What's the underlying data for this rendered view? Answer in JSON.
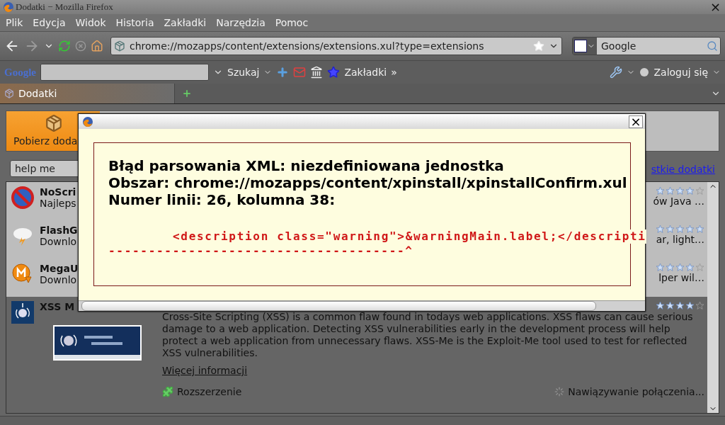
{
  "window": {
    "title": "Dodatki − Mozilla Firefox"
  },
  "menu": [
    "Plik",
    "Edycja",
    "Widok",
    "Historia",
    "Zakładki",
    "Narzędzia",
    "Pomoc"
  ],
  "nav": {
    "forward_disabled": true,
    "url": "chrome://mozapps/content/extensions/extensions.xul?type=extensions",
    "search": "Google"
  },
  "google_toolbar": {
    "logo": "Google",
    "search_button": "Szukaj",
    "bookmarks": "Zakładki",
    "overflow": "»",
    "login": "Zaloguj się"
  },
  "tabs": [
    {
      "label": "Dodatki",
      "selected": true
    }
  ],
  "addons": {
    "get_button": "Pobierz doda",
    "search": {
      "value": "help me"
    },
    "all_link": "stkie dodatki",
    "items": [
      {
        "kind": "blocked",
        "name": "NoScri",
        "description": "Najleps",
        "tail": "ów Java …",
        "stars": 4,
        "selected": false
      },
      {
        "kind": "storm",
        "name": "FlashG",
        "description": "Downlo",
        "tail": "ar, light…",
        "stars": 5,
        "selected": false
      },
      {
        "kind": "download",
        "name": "MegaU",
        "description": "Downlo",
        "tail": "lper wil…",
        "stars": 4,
        "selected": false
      },
      {
        "kind": "globe",
        "name": "XSS M",
        "stars": 4,
        "selected": true,
        "details": {
          "text": "Cross-Site Scripting (XSS) is a common flaw found in todays web applications. XSS flaws can cause serious damage to a web application. Detecting XSS vulnerabilities early in the development process will help protect a web application from unnecessary flaws. XSS-Me is the Exploit-Me tool used to test for reflected XSS vulnerabilities.",
          "more_link": "Więcej informacji",
          "type": "Rozszerzenie",
          "status": "Nawiązywanie połączenia..."
        }
      }
    ]
  },
  "dialog": {
    "close": "×",
    "heading": [
      "Błąd parsowania XML: niezdefiniowana jednostka",
      "Obszar: chrome://mozapps/content/xpinstall/xpinstallConfirm.xul",
      "Numer linii: 26, kolumna 38:"
    ],
    "source_line": "<description class=\"warning\">&warningMain.label;</descripti",
    "pointer_line": "-------------------------------------^"
  },
  "window_close": "×"
}
